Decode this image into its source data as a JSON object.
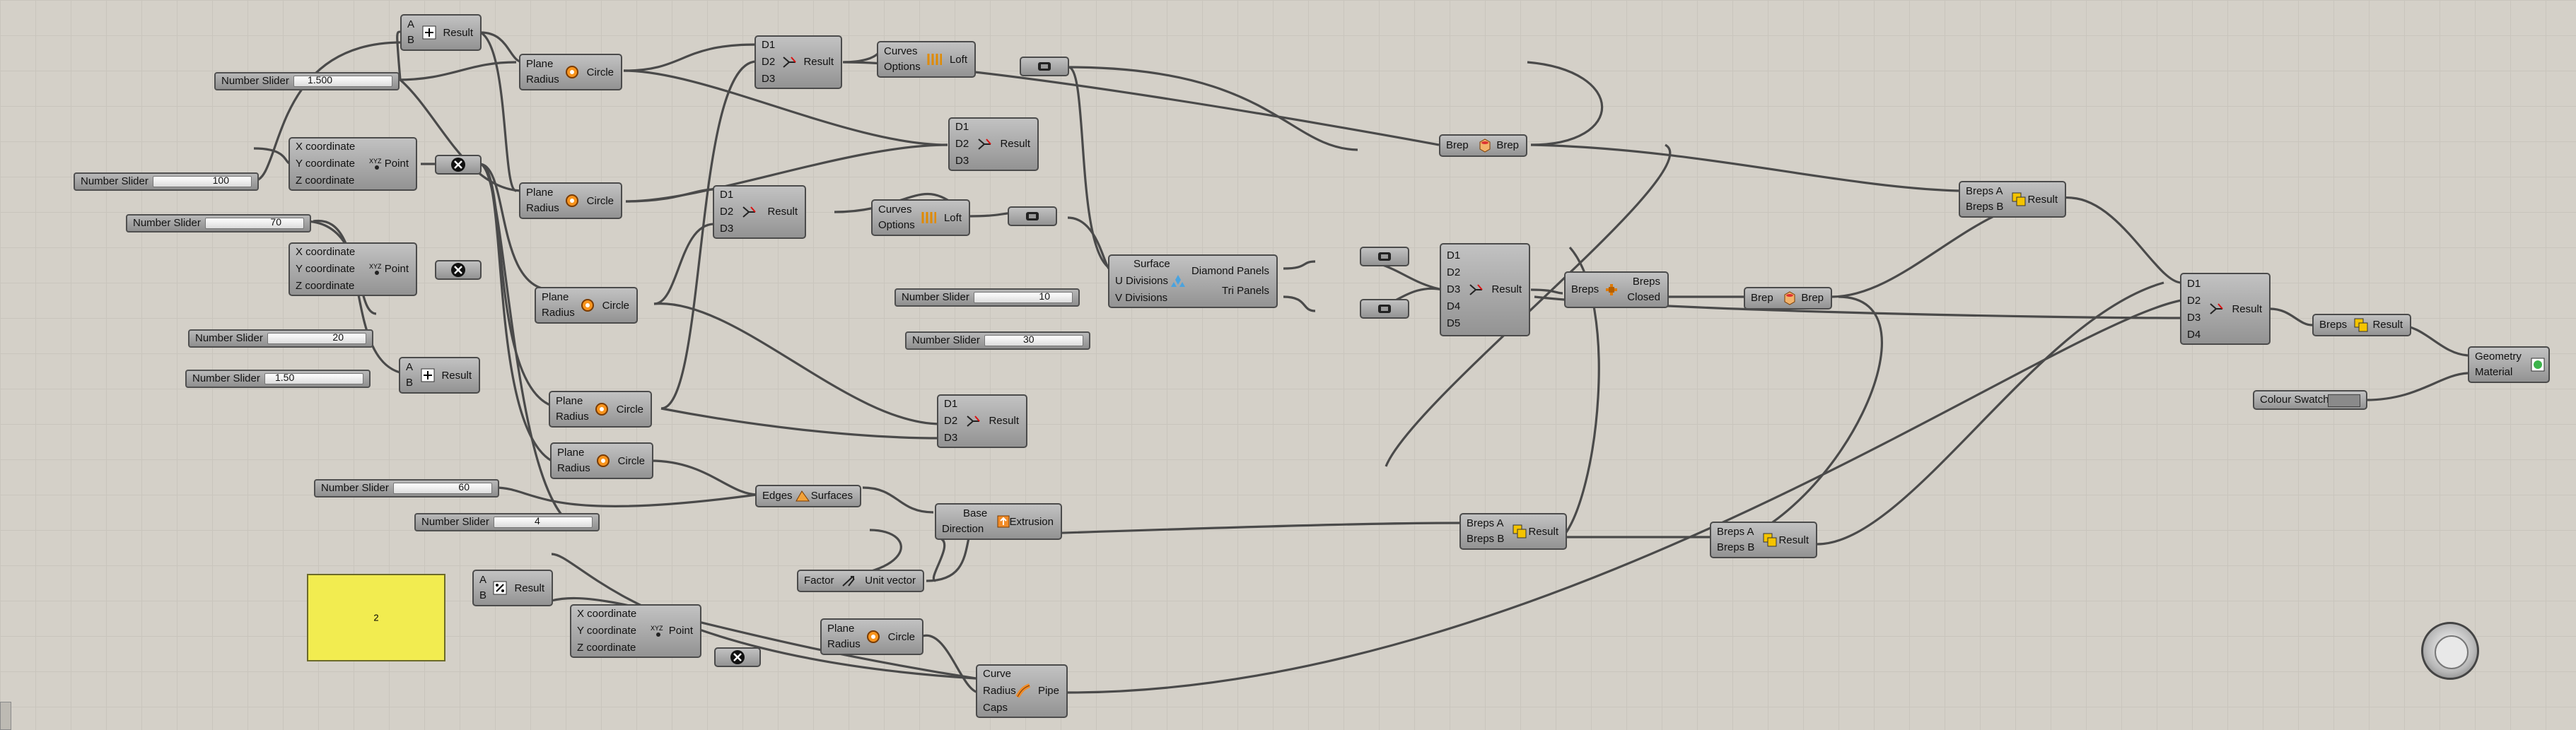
{
  "canvas": {
    "background": "#d4d0c8",
    "grid_color": "#c9c5bd"
  },
  "sliders": [
    {
      "label": "Number Slider",
      "value": "1.500"
    },
    {
      "label": "Number Slider",
      "value": "100"
    },
    {
      "label": "Number Slider",
      "value": "70"
    },
    {
      "label": "Number Slider",
      "value": "20"
    },
    {
      "label": "Number Slider",
      "value": "1.50"
    },
    {
      "label": "Number Slider",
      "value": "60"
    },
    {
      "label": "Number Slider",
      "value": "4"
    },
    {
      "label": "Number Slider",
      "value": "10"
    },
    {
      "label": "Number Slider",
      "value": "30"
    }
  ],
  "components": {
    "addition_top": {
      "inputs": [
        "A",
        "B"
      ],
      "output": "Result"
    },
    "addition_mid": {
      "inputs": [
        "A",
        "B"
      ],
      "output": "Result"
    },
    "division": {
      "inputs": [
        "A",
        "B"
      ],
      "output": "Result"
    },
    "point_top": {
      "inputs": [
        "X coordinate",
        "Y coordinate",
        "Z coordinate"
      ],
      "output": "Point"
    },
    "point_mid": {
      "inputs": [
        "X coordinate",
        "Y coordinate",
        "Z coordinate"
      ],
      "output": "Point"
    },
    "point_low": {
      "inputs": [
        "X coordinate",
        "Y coordinate",
        "Z coordinate"
      ],
      "output": "Point"
    },
    "circle_1": {
      "inputs": [
        "Plane",
        "Radius"
      ],
      "output": "Circle"
    },
    "circle_2": {
      "inputs": [
        "Plane",
        "Radius"
      ],
      "output": "Circle"
    },
    "circle_3": {
      "inputs": [
        "Plane",
        "Radius"
      ],
      "output": "Circle"
    },
    "circle_4": {
      "inputs": [
        "Plane",
        "Radius"
      ],
      "output": "Circle"
    },
    "circle_5": {
      "inputs": [
        "Plane",
        "Radius"
      ],
      "output": "Circle"
    },
    "circle_6": {
      "inputs": [
        "Plane",
        "Radius"
      ],
      "output": "Circle"
    },
    "merge_1": {
      "inputs": [
        "D1",
        "D2",
        "D3"
      ],
      "output": "Result"
    },
    "merge_2": {
      "inputs": [
        "D1",
        "D2",
        "D3"
      ],
      "output": "Result"
    },
    "merge_3": {
      "inputs": [
        "D1",
        "D2",
        "D3"
      ],
      "output": "Result"
    },
    "merge_4": {
      "inputs": [
        "D1",
        "D2",
        "D3"
      ],
      "output": "Result"
    },
    "merge_5": {
      "inputs": [
        "D1",
        "D2",
        "D3",
        "D4",
        "D5"
      ],
      "output": "Result"
    },
    "merge_6": {
      "inputs": [
        "D1",
        "D2",
        "D3",
        "D4"
      ],
      "output": "Result"
    },
    "loft_1": {
      "inputs": [
        "Curves",
        "Options"
      ],
      "output": "Loft"
    },
    "loft_2": {
      "inputs": [
        "Curves",
        "Options"
      ],
      "output": "Loft"
    },
    "lunchbox": {
      "inputs": [
        "Surface",
        "U Divisions",
        "V Divisions"
      ],
      "outputs": [
        "Diamond Panels",
        "Tri Panels"
      ]
    },
    "brep_1": {
      "input": "Brep",
      "output": "Brep"
    },
    "brep_2": {
      "input": "Brep",
      "output": "Brep"
    },
    "join": {
      "input": "Breps",
      "outputs": [
        "Breps",
        "Closed"
      ]
    },
    "boolean_1": {
      "inputs": [
        "Breps A",
        "Breps B"
      ],
      "output": "Result"
    },
    "boolean_2": {
      "inputs": [
        "Breps A",
        "Breps B"
      ],
      "output": "Result"
    },
    "boolean_3": {
      "inputs": [
        "Breps A",
        "Breps B"
      ],
      "output": "Result"
    },
    "union_final": {
      "input": "Breps",
      "output": "Result"
    },
    "boundary": {
      "input": "Edges",
      "output": "Surfaces"
    },
    "extrusion": {
      "inputs": [
        "Base",
        "Direction"
      ],
      "output": "Extrusion"
    },
    "unit_vector": {
      "input": "Factor",
      "output": "Unit vector"
    },
    "pipe": {
      "inputs": [
        "Curve",
        "Radius",
        "Caps"
      ],
      "output": "Pipe"
    },
    "preview": {
      "inputs": [
        "Geometry",
        "Material"
      ]
    },
    "colour_swatch": {
      "label": "Colour Swatch",
      "color": "#8a8a8a"
    }
  },
  "panel": {
    "text": "2",
    "color": "#f2ec50"
  }
}
